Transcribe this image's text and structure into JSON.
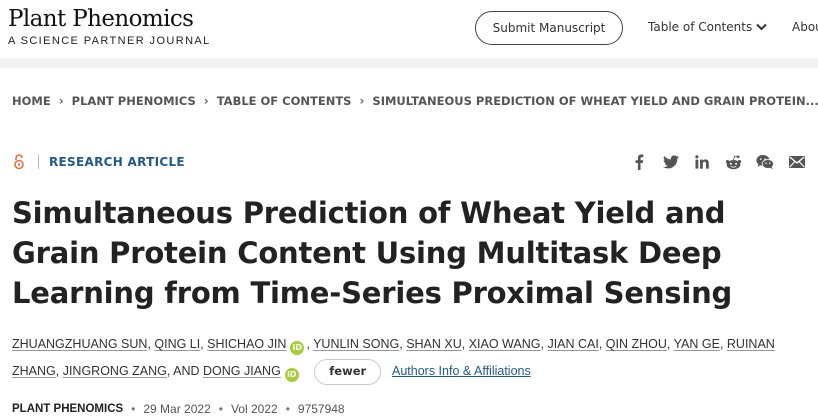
{
  "header": {
    "brand_title": "Plant Phenomics",
    "brand_subtitle": "A SCIENCE PARTNER JOURNAL",
    "submit_label": "Submit Manuscript",
    "toc_label": "Table of Contents",
    "about_label": "About"
  },
  "breadcrumb": {
    "items": [
      "HOME",
      "PLANT PHENOMICS",
      "TABLE OF CONTENTS",
      "SIMULTANEOUS PREDICTION OF WHEAT YIELD AND GRAIN PROTEIN..."
    ]
  },
  "article": {
    "type_label": "RESEARCH ARTICLE",
    "title": "Simultaneous Prediction of Wheat Yield and Grain Protein Content Using Multitask Deep Learning from Time-Series Proximal Sensing",
    "authors": [
      "ZHUANGZHUANG SUN",
      "QING LI",
      "SHICHAO JIN",
      "YUNLIN SONG",
      "SHAN XU",
      "XIAO WANG",
      "JIAN CAI",
      "QIN ZHOU",
      "YAN GE",
      "RUINAN ZHANG",
      "JINGRONG ZANG",
      "DONG JIANG"
    ],
    "and_word": ", AND",
    "orcid_text": "iD",
    "fewer_label": "fewer",
    "affiliations_label": "Authors Info & Affiliations",
    "journal": "PLANT PHENOMICS",
    "date": "29 Mar 2022",
    "volume": "Vol 2022",
    "article_number": "9757948"
  },
  "share": {
    "icons": [
      "facebook-icon",
      "twitter-icon",
      "linkedin-icon",
      "reddit-icon",
      "wechat-icon",
      "email-icon"
    ]
  },
  "colors": {
    "accent_blue": "#1f5a8a",
    "open_access_orange": "#e8703a",
    "orcid_green": "#a6ce39"
  }
}
